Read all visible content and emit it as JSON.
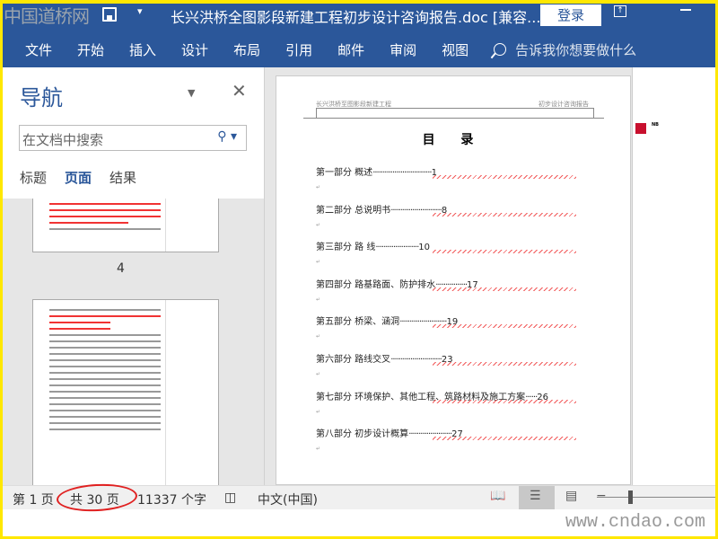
{
  "watermark_logo": "中国道桥网",
  "title": "长兴洪桥全图影段新建工程初步设计咨询报告.doc [兼容...",
  "login": "登录",
  "ribbon": {
    "tabs": [
      "文件",
      "开始",
      "插入",
      "设计",
      "布局",
      "引用",
      "邮件",
      "审阅",
      "视图"
    ],
    "tell_me": "告诉我你想要做什么"
  },
  "nav": {
    "title": "导航",
    "search_placeholder": "在文档中搜索",
    "tabs": [
      "标题",
      "页面",
      "结果"
    ],
    "page_label": "4"
  },
  "doc": {
    "header_left": "长兴洪桥至图影段新建工程",
    "header_right": "初步设计咨询报告",
    "toc_title": "目 录",
    "toc": [
      {
        "label": "第一部分  概述",
        "page": "1"
      },
      {
        "label": "第二部分  总说明书",
        "page": "8"
      },
      {
        "label": "第三部分  路    线",
        "page": "10"
      },
      {
        "label": "第四部分  路基路面、防护排水",
        "page": "17"
      },
      {
        "label": "第五部分  桥梁、涵洞",
        "page": "19"
      },
      {
        "label": "第六部分  路线交叉",
        "page": "23"
      },
      {
        "label": "第七部分  环境保护、其他工程、筑路材料及施工方案",
        "page": "26"
      },
      {
        "label": "第八部分  初步设计概算",
        "page": "27"
      }
    ],
    "comment_author": "NB"
  },
  "status": {
    "page": "第 1 页",
    "total": "共 30 页",
    "words": "11337 个字",
    "lang": "中文(中国)"
  },
  "site_watermark": "www.cndao.com"
}
